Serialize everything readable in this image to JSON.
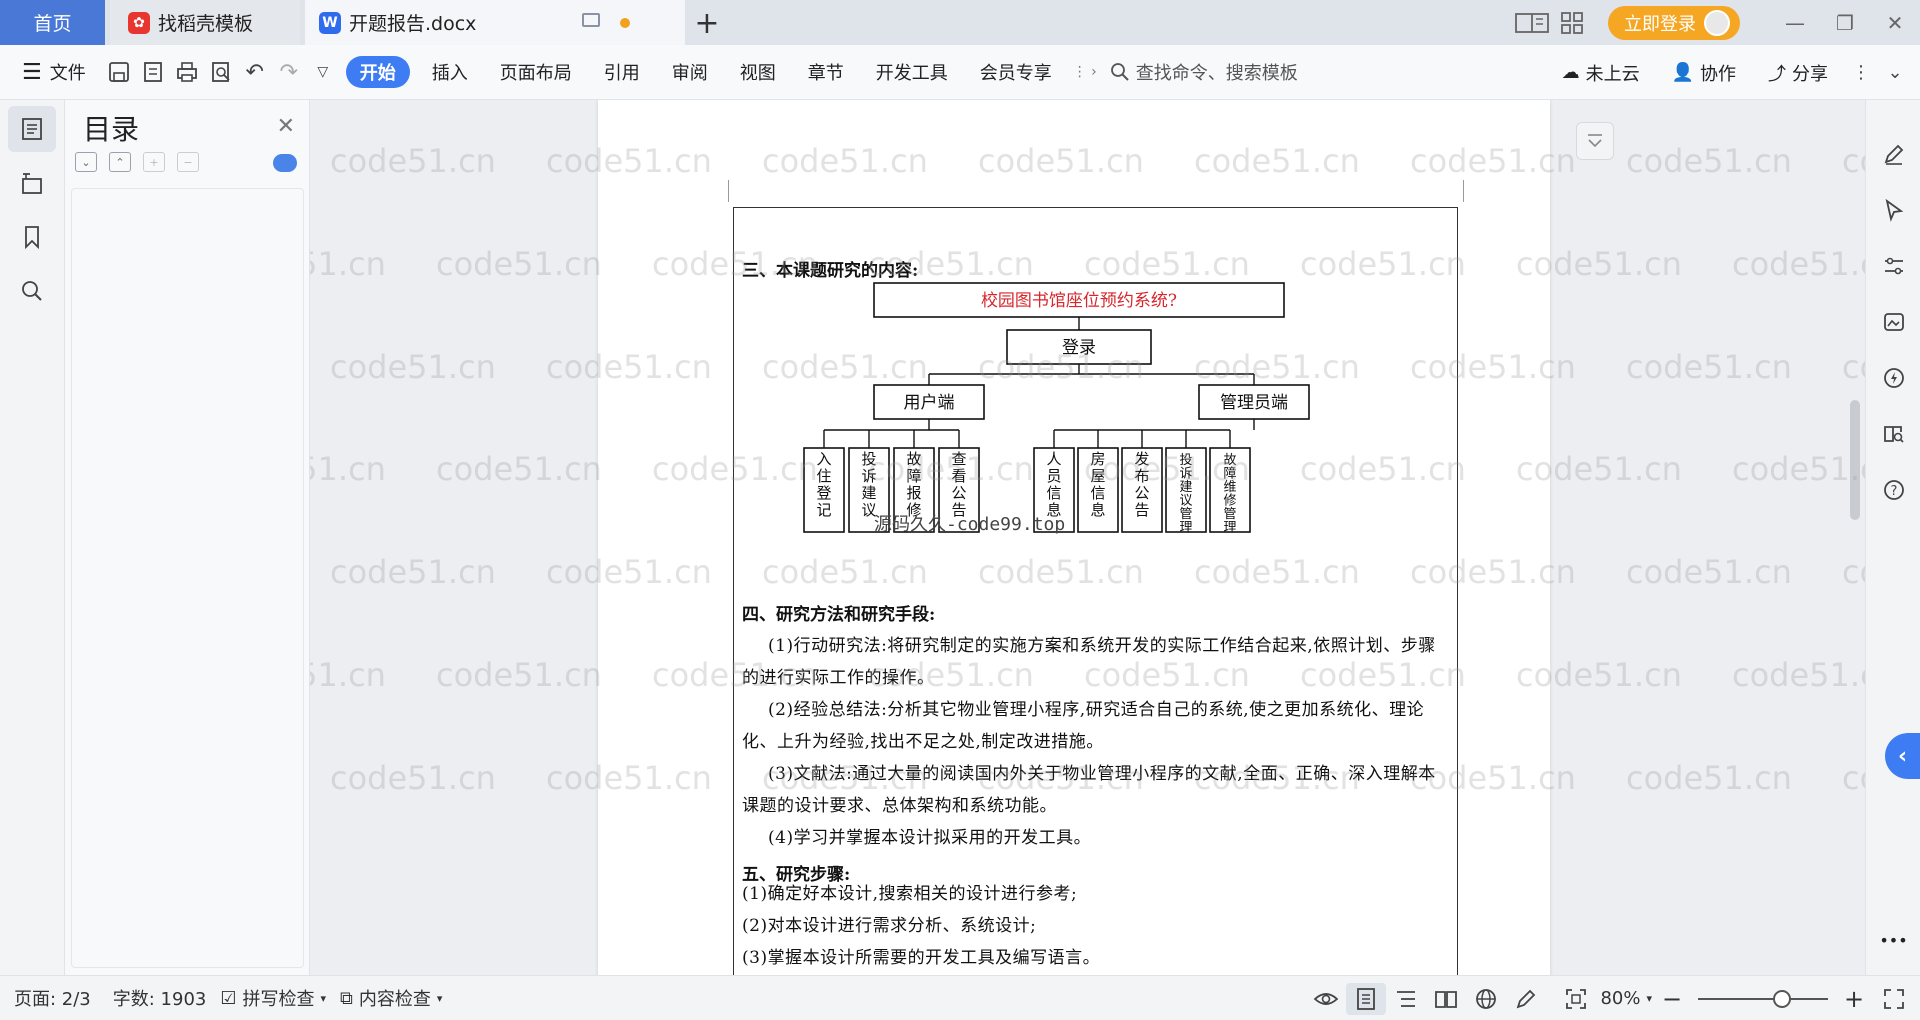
{
  "tabs": {
    "home": "首页",
    "templates": "找稻壳模板",
    "document": "开题报告.docx",
    "add": "+"
  },
  "window": {
    "login_label": "立即登录"
  },
  "toolbar": {
    "file": "文件",
    "start": "开始",
    "insert": "插入",
    "layout": "页面布局",
    "reference": "引用",
    "review": "审阅",
    "view": "视图",
    "chapter": "章节",
    "devtools": "开发工具",
    "member": "会员专享",
    "search_placeholder": "查找命令、搜索模板",
    "cloud": "未上云",
    "collab": "协作",
    "share": "分享"
  },
  "toc": {
    "title": "目录"
  },
  "doc": {
    "section3_title": "三、本课题研究的内容:",
    "diagram": {
      "root": "校园图书馆座位预约系统?",
      "login": "登录",
      "user_side": "用户端",
      "admin_side": "管理员端",
      "user_items": [
        "入住登记",
        "投诉建议",
        "故障报修",
        "查看公告"
      ],
      "admin_items": [
        "人员信息",
        "房屋信息",
        "发布公告",
        "投诉建议管理",
        "故障维修管理"
      ]
    },
    "section4_title": "四、研究方法和研究手段:",
    "p1": "(1)行动研究法:将研究制定的实施方案和系统开发的实际工作结合起来,依照计划、步骤的进行实际工作的操作。",
    "p2": "(2)经验总结法:分析其它物业管理小程序,研究适合自己的系统,使之更加系统化、理论化、上升为经验,找出不足之处,制定改进措施。",
    "p3": "(3)文献法:通过大量的阅读国内外关于物业管理小程序的文献,全面、正确、深入理解本课题的设计要求、总体架构和系统功能。",
    "p4": "(4)学习并掌握本设计拟采用的开发工具。",
    "section5_title": "五、研究步骤:",
    "s1": "(1)确定好本设计,搜索相关的设计进行参考;",
    "s2": "(2)对本设计进行需求分析、系统设计;",
    "s3": "(3)掌握本设计所需要的开发工具及编写语言。"
  },
  "watermark": {
    "text": "code51.cn",
    "overlay": "源码久久-code99.top"
  },
  "status": {
    "page": "页面: 2/3",
    "words": "字数: 1903",
    "spell": "拼写检查",
    "content_check": "内容检查",
    "zoom": "80%"
  },
  "colors": {
    "accent": "#3d7cf2",
    "home_tab": "#4a78d6",
    "login": "#f5a623",
    "diagram_root_text": "#d8262c"
  }
}
